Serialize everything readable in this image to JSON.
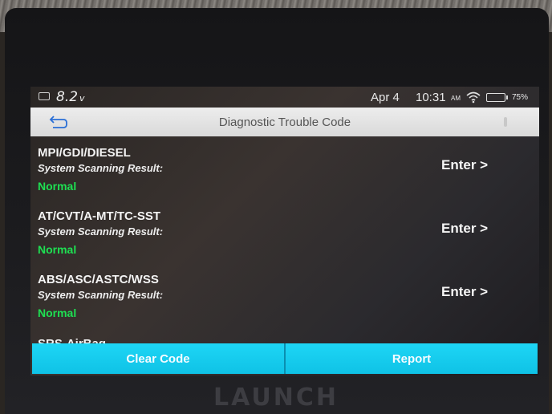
{
  "status_bar": {
    "voltage": "8.2",
    "voltage_unit": "v",
    "date": "Apr 4",
    "time": "10:31",
    "ampm": "AM",
    "battery_percent": "75%"
  },
  "header": {
    "title": "Diagnostic Trouble Code"
  },
  "systems": [
    {
      "name": "MPI/GDI/DIESEL",
      "scan_label": "System Scanning Result:",
      "status": "Normal",
      "action": "Enter >"
    },
    {
      "name": "AT/CVT/A-MT/TC-SST",
      "scan_label": "System Scanning Result:",
      "status": "Normal",
      "action": "Enter >"
    },
    {
      "name": "ABS/ASC/ASTC/WSS",
      "scan_label": "System Scanning Result:",
      "status": "Normal",
      "action": "Enter >"
    },
    {
      "name": "SRS-AirBag",
      "scan_label": "",
      "status": "",
      "action": ""
    }
  ],
  "footer": {
    "clear_code": "Clear Code",
    "report": "Report"
  },
  "brand": "LAUNCH",
  "colors": {
    "accent": "#14cbee",
    "status_normal": "#1ee052"
  }
}
